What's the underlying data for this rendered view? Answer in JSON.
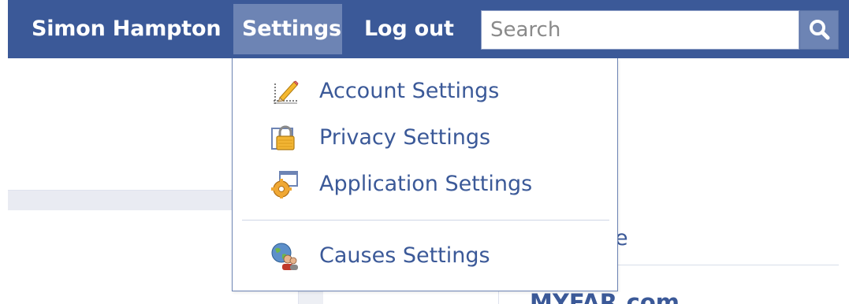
{
  "header": {
    "user_name": "Simon Hampton",
    "settings_label": "Settings",
    "logout_label": "Log out",
    "search": {
      "placeholder": "Search",
      "value": ""
    },
    "search_button_icon": "magnifier-icon"
  },
  "settings_menu": {
    "items": [
      {
        "label": "Account Settings",
        "icon": "pencil-ruler-icon"
      },
      {
        "label": "Privacy Settings",
        "icon": "padlock-icon"
      },
      {
        "label": "Application Settings",
        "icon": "gear-window-icon"
      },
      {
        "label": "Causes Settings",
        "icon": "globe-people-icon"
      }
    ]
  },
  "background": {
    "partial_text": "e",
    "partial_title": "MYFAR.com"
  },
  "colors": {
    "bar": "#3b5998",
    "active_tab": "#6d84b4",
    "link": "#3b5998"
  }
}
